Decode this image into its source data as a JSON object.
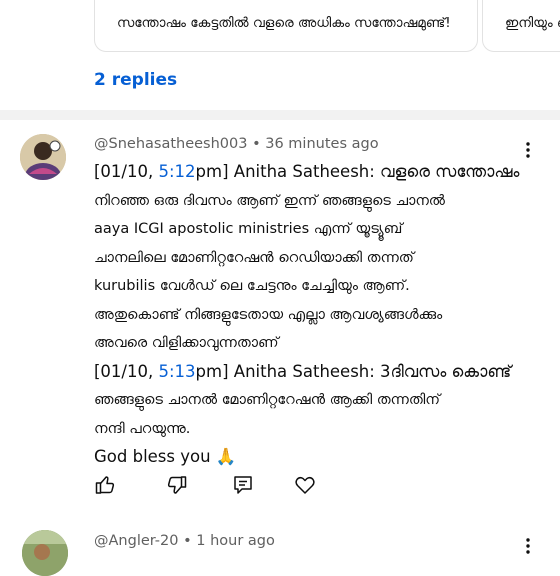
{
  "chips": [
    {
      "text": "സന്തോഷം കേട്ടതിൽ വളരെ അധികം സന്തോഷമുണ്ട്!"
    },
    {
      "text": "ഇനിയും ഒര"
    }
  ],
  "replies_label": "2 replies",
  "comments": [
    {
      "handle": "@Snehasatheesh003",
      "separator": "•",
      "time": "36 minutes ago",
      "lines": [
        {
          "pre": "[01/10, ",
          "ts": "5:12",
          "post": "pm] Anitha Satheesh: വളരെ സന്തോഷം"
        },
        {
          "text": "നിറഞ്ഞ ഒരു ദിവസം ആണ് ഇന്ന് ഞങ്ങളുടെ ചാനൽ"
        },
        {
          "text": "aaya ICGI apostolic ministries എന്ന് യൂട്യൂബ്"
        },
        {
          "text": "ചാനലിലെ മോണിറ്ററേഷൻ റെഡിയാക്കി തന്നത്"
        },
        {
          "text": "kurubilis വേൾഡ് ലെ ചേട്ടനും ചേച്ചിയും ആണ്."
        },
        {
          "text": "അതുകൊണ്ട് നിങ്ങളുടേതായ എല്ലാ ആവശ്യങ്ങൾക്കും"
        },
        {
          "text": "അവരെ വിളിക്കാവുന്നതാണ്"
        },
        {
          "pre": "[01/10, ",
          "ts": "5:13",
          "post": "pm] Anitha Satheesh: 3ദിവസം കൊണ്ട്"
        },
        {
          "text": "ഞങ്ങളുടെ ചാനൽ മോണിറ്ററേഷൻ ആക്കി തന്നതിന്"
        },
        {
          "text": "നന്ദി പറയുന്നു."
        },
        {
          "text": "God bless you 🙏"
        }
      ]
    },
    {
      "handle": "@Angler-20",
      "separator": "•",
      "time": "1 hour ago"
    }
  ],
  "icons": {
    "like": "thumbs-up-icon",
    "dislike": "thumbs-down-icon",
    "reply": "reply-icon",
    "heart": "heart-icon",
    "more": "more-vert-icon"
  },
  "colors": {
    "link": "#065fd4",
    "meta": "#606060",
    "text": "#0f0f0f",
    "divider": "#f2f2f2"
  }
}
